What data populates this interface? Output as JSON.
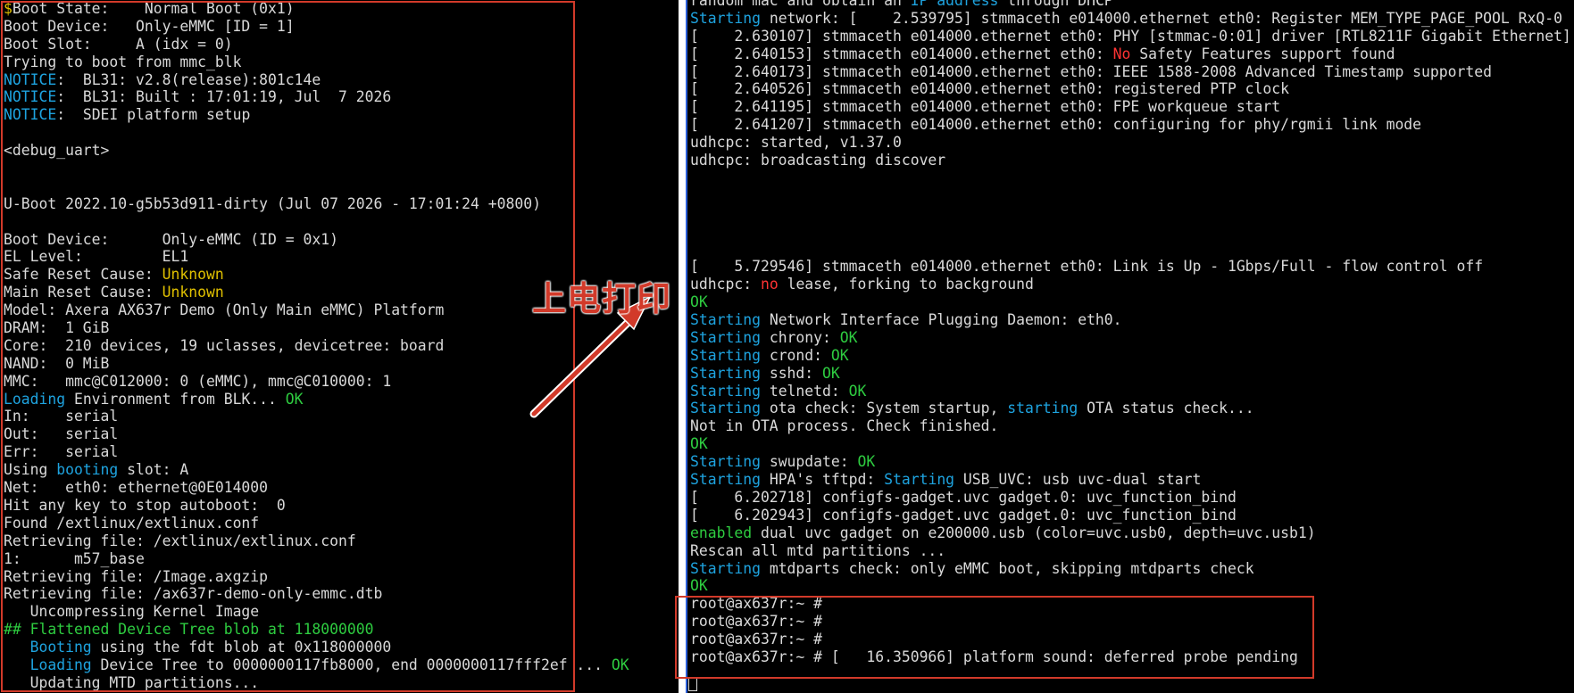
{
  "annotation": {
    "label": "上电打印",
    "color": "#d23a2a"
  },
  "colors": {
    "background": "#000000",
    "text": "#d9d9d9",
    "cyan": "#1ea3df",
    "green": "#2ecc40",
    "yellow": "#e0c000",
    "red": "#ff3333",
    "highlight": "#d23a2a"
  },
  "left_terminal": {
    "lines": [
      [
        [
          "y",
          "$"
        ],
        [
          "",
          "Boot State:    Normal Boot (0x1)"
        ]
      ],
      [
        [
          "",
          "Boot Device:   Only-eMMC [ID = 1]"
        ]
      ],
      [
        [
          "",
          "Boot Slot:     A (idx = 0)"
        ]
      ],
      [
        [
          "",
          "Trying to boot from mmc_blk"
        ]
      ],
      [
        [
          "c",
          "NOTICE"
        ],
        [
          "",
          ":  BL31: v2.8(release):801c14e"
        ]
      ],
      [
        [
          "c",
          "NOTICE"
        ],
        [
          "",
          ":  BL31: Built : 17:01:19, Jul  7 2026"
        ]
      ],
      [
        [
          "c",
          "NOTICE"
        ],
        [
          "",
          ":  SDEI platform setup"
        ]
      ],
      [
        [
          "",
          ""
        ]
      ],
      [
        [
          "",
          "<debug_uart>"
        ]
      ],
      [
        [
          "",
          ""
        ]
      ],
      [
        [
          "",
          ""
        ]
      ],
      [
        [
          "",
          "U-Boot 2022.10-g5b53d911-dirty (Jul 07 2026 - 17:01:24 +0800)"
        ]
      ],
      [
        [
          "",
          ""
        ]
      ],
      [
        [
          "",
          "Boot Device:      Only-eMMC (ID = 0x1)"
        ]
      ],
      [
        [
          "",
          "EL Level:         EL1"
        ]
      ],
      [
        [
          "",
          "Safe Reset Cause: "
        ],
        [
          "y",
          "Unknown"
        ]
      ],
      [
        [
          "",
          "Main Reset Cause: "
        ],
        [
          "y",
          "Unknown"
        ]
      ],
      [
        [
          "",
          "Model: Axera AX637r Demo (Only Main eMMC) Platform"
        ]
      ],
      [
        [
          "",
          "DRAM:  1 GiB"
        ]
      ],
      [
        [
          "",
          "Core:  210 devices, 19 uclasses, devicetree: board"
        ]
      ],
      [
        [
          "",
          "NAND:  0 MiB"
        ]
      ],
      [
        [
          "",
          "MMC:   mmc@C012000: 0 (eMMC), mmc@C010000: 1"
        ]
      ],
      [
        [
          "c",
          "Loading"
        ],
        [
          "",
          " Environment from BLK... "
        ],
        [
          "g",
          "OK"
        ]
      ],
      [
        [
          "",
          "In:    serial"
        ]
      ],
      [
        [
          "",
          "Out:   serial"
        ]
      ],
      [
        [
          "",
          "Err:   serial"
        ]
      ],
      [
        [
          "",
          "Using "
        ],
        [
          "c",
          "booting"
        ],
        [
          "",
          " slot: A"
        ]
      ],
      [
        [
          "",
          "Net:   eth0: ethernet@0E014000"
        ]
      ],
      [
        [
          "",
          "Hit any key to stop autoboot:  0"
        ]
      ],
      [
        [
          "",
          "Found /extlinux/extlinux.conf"
        ]
      ],
      [
        [
          "",
          "Retrieving file: /extlinux/extlinux.conf"
        ]
      ],
      [
        [
          "",
          "1:      m57_base"
        ]
      ],
      [
        [
          "",
          "Retrieving file: /Image.axgzip"
        ]
      ],
      [
        [
          "",
          "Retrieving file: /ax637r-demo-only-emmc.dtb"
        ]
      ],
      [
        [
          "",
          "   Uncompressing Kernel Image"
        ]
      ],
      [
        [
          "g",
          "## Flattened Device Tree blob at 118000000"
        ]
      ],
      [
        [
          "c",
          "   Booting"
        ],
        [
          "",
          " using the fdt blob at 0x118000000"
        ]
      ],
      [
        [
          "c",
          "   Loading"
        ],
        [
          "",
          " Device Tree to 0000000117fb8000, end 0000000117fff2ef ... "
        ],
        [
          "g",
          "OK"
        ]
      ],
      [
        [
          "",
          "   Updating MTD partitions..."
        ]
      ]
    ]
  },
  "right_terminal": {
    "lines": [
      [
        [
          "",
          "random mac and obtain an "
        ],
        [
          "c",
          "IP address"
        ],
        [
          "",
          " through DHCP"
        ]
      ],
      [
        [
          "c",
          "Starting"
        ],
        [
          "",
          " network: [    2.539795] stmmaceth e014000.ethernet eth0: Register MEM_TYPE_PAGE_POOL RxQ-0"
        ]
      ],
      [
        [
          "",
          "[    2.630107] stmmaceth e014000.ethernet eth0: PHY [stmmac-0:01] driver [RTL8211F Gigabit Ethernet]"
        ]
      ],
      [
        [
          "",
          "[    2.640153] stmmaceth e014000.ethernet eth0: "
        ],
        [
          "r",
          "No"
        ],
        [
          "",
          " Safety Features support found"
        ]
      ],
      [
        [
          "",
          "[    2.640173] stmmaceth e014000.ethernet eth0: IEEE 1588-2008 Advanced Timestamp supported"
        ]
      ],
      [
        [
          "",
          "[    2.640526] stmmaceth e014000.ethernet eth0: registered PTP clock"
        ]
      ],
      [
        [
          "",
          "[    2.641195] stmmaceth e014000.ethernet eth0: FPE workqueue start"
        ]
      ],
      [
        [
          "",
          "[    2.641207] stmmaceth e014000.ethernet eth0: configuring for phy/rgmii link mode"
        ]
      ],
      [
        [
          "",
          "udhcpc: started, v1.37.0"
        ]
      ],
      [
        [
          "",
          "udhcpc: broadcasting discover"
        ]
      ],
      [
        [
          "",
          ""
        ]
      ],
      [
        [
          "",
          ""
        ]
      ],
      [
        [
          "",
          ""
        ]
      ],
      [
        [
          "",
          ""
        ]
      ],
      [
        [
          "",
          ""
        ]
      ],
      [
        [
          "",
          "[    5.729546] stmmaceth e014000.ethernet eth0: Link is Up - 1Gbps/Full - flow control off"
        ]
      ],
      [
        [
          "",
          "udhcpc: "
        ],
        [
          "r",
          "no"
        ],
        [
          "",
          " lease, forking to background"
        ]
      ],
      [
        [
          "g",
          "OK"
        ]
      ],
      [
        [
          "c",
          "Starting"
        ],
        [
          "",
          " Network Interface Plugging Daemon: eth0."
        ]
      ],
      [
        [
          "c",
          "Starting"
        ],
        [
          "",
          " chrony: "
        ],
        [
          "g",
          "OK"
        ]
      ],
      [
        [
          "c",
          "Starting"
        ],
        [
          "",
          " crond: "
        ],
        [
          "g",
          "OK"
        ]
      ],
      [
        [
          "c",
          "Starting"
        ],
        [
          "",
          " sshd: "
        ],
        [
          "g",
          "OK"
        ]
      ],
      [
        [
          "c",
          "Starting"
        ],
        [
          "",
          " telnetd: "
        ],
        [
          "g",
          "OK"
        ]
      ],
      [
        [
          "c",
          "Starting"
        ],
        [
          "",
          " ota check: System startup, "
        ],
        [
          "c",
          "starting"
        ],
        [
          "",
          " OTA status check..."
        ]
      ],
      [
        [
          "",
          "Not in OTA process. Check finished."
        ]
      ],
      [
        [
          "g",
          "OK"
        ]
      ],
      [
        [
          "c",
          "Starting"
        ],
        [
          "",
          " swupdate: "
        ],
        [
          "g",
          "OK"
        ]
      ],
      [
        [
          "c",
          "Starting"
        ],
        [
          "",
          " HPA's tftpd: "
        ],
        [
          "c",
          "Starting"
        ],
        [
          "",
          " USB_UVC: usb uvc-dual start"
        ]
      ],
      [
        [
          "",
          "[    6.202718] configfs-gadget.uvc gadget.0: uvc_function_bind"
        ]
      ],
      [
        [
          "",
          "[    6.202943] configfs-gadget.uvc gadget.0: uvc_function_bind"
        ]
      ],
      [
        [
          "g",
          "enabled"
        ],
        [
          "",
          " dual uvc gadget on e200000.usb (color=uvc.usb0, depth=uvc.usb1)"
        ]
      ],
      [
        [
          "",
          "Rescan all mtd partitions ..."
        ]
      ],
      [
        [
          "c",
          "Starting"
        ],
        [
          "",
          " mtdparts check: only eMMC boot, skipping mtdparts check"
        ]
      ],
      [
        [
          "g",
          "OK"
        ]
      ],
      [
        [
          "",
          "root@ax637r:~ #"
        ]
      ],
      [
        [
          "",
          "root@ax637r:~ #"
        ]
      ],
      [
        [
          "",
          "root@ax637r:~ #"
        ]
      ],
      [
        [
          "",
          "root@ax637r:~ # [   16.350966] platform sound: deferred probe pending"
        ]
      ]
    ]
  }
}
